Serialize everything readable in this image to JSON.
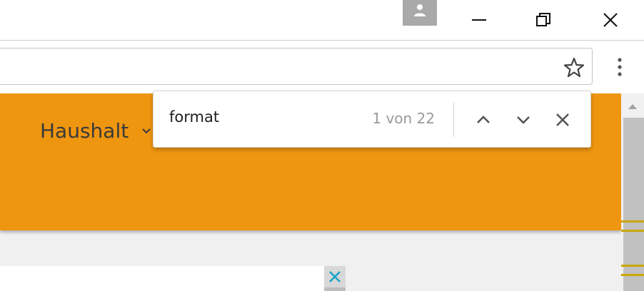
{
  "window": {
    "profile_icon": "person-icon",
    "minimize_icon": "minimize-icon",
    "restore_icon": "restore-icon",
    "close_icon": "close-icon"
  },
  "toolbar": {
    "bookmark_icon": "star-icon",
    "menu_icon": "kebab-menu-icon"
  },
  "find_bar": {
    "query": "format",
    "match_count": "1 von 22",
    "prev_icon": "chevron-up-icon",
    "next_icon": "chevron-down-icon",
    "close_icon": "close-icon"
  },
  "page": {
    "nav_item": "Haushalt",
    "banner_color": "#ef9610",
    "ad_close_icon": "close-icon",
    "ad_close_color": "#1aa3c7"
  },
  "scrollbar": {
    "match_marker_color": "#c8a800"
  }
}
